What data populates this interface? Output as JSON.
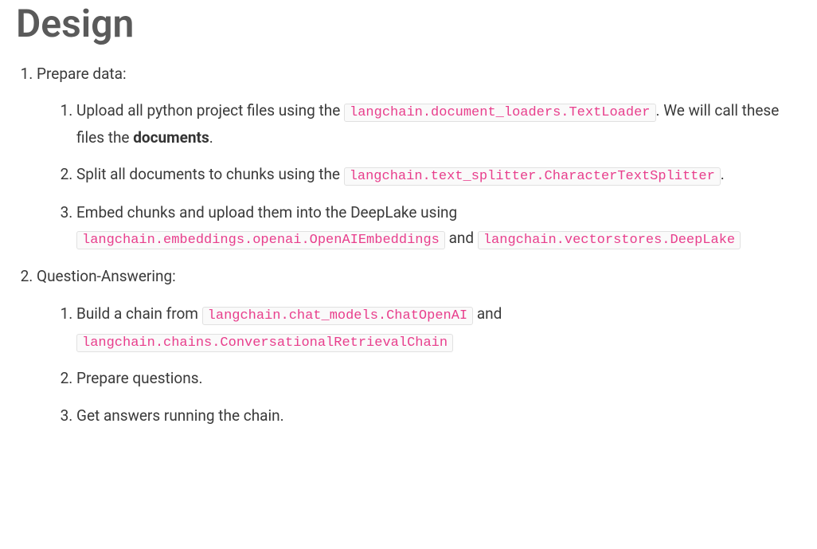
{
  "heading": "Design",
  "sections": [
    {
      "title": "Prepare data:",
      "items": [
        {
          "pre": "Upload all python project files using the ",
          "code1": "langchain.document_loaders.TextLoader",
          "mid1": ". We will call these files the ",
          "bold": "documents",
          "post": "."
        },
        {
          "pre": "Split all documents to chunks using the ",
          "code1": "langchain.text_splitter.CharacterTextSplitter",
          "post": "."
        },
        {
          "pre": "Embed chunks and upload them into the DeepLake using ",
          "code1": "langchain.embeddings.openai.OpenAIEmbeddings",
          "mid1": " and ",
          "code2": "langchain.vectorstores.DeepLake"
        }
      ]
    },
    {
      "title": "Question-Answering:",
      "items": [
        {
          "pre": "Build a chain from ",
          "code1": "langchain.chat_models.ChatOpenAI",
          "mid1": " and ",
          "code2": "langchain.chains.ConversationalRetrievalChain"
        },
        {
          "pre": "Prepare questions."
        },
        {
          "pre": "Get answers running the chain."
        }
      ]
    }
  ]
}
